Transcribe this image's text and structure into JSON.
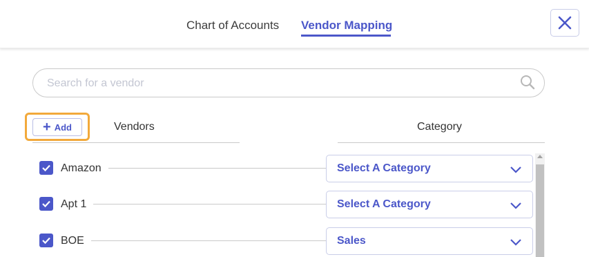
{
  "tabs": [
    {
      "label": "Chart of Accounts",
      "active": false
    },
    {
      "label": "Vendor Mapping",
      "active": true
    }
  ],
  "close_icon": "close-icon",
  "search": {
    "placeholder": "Search for a vendor",
    "value": "",
    "icon": "search-icon"
  },
  "add_button": {
    "label": "Add",
    "icon": "plus-icon"
  },
  "columns": {
    "vendors": "Vendors",
    "category": "Category"
  },
  "rows": [
    {
      "vendor": "Amazon",
      "checked": true,
      "category": "Select A Category"
    },
    {
      "vendor": "Apt 1",
      "checked": true,
      "category": "Select A Category"
    },
    {
      "vendor": "BOE",
      "checked": true,
      "category": "Sales"
    }
  ],
  "colors": {
    "accent": "#4b57c9",
    "highlight": "#f2a93b",
    "border": "#c9c9c9"
  }
}
